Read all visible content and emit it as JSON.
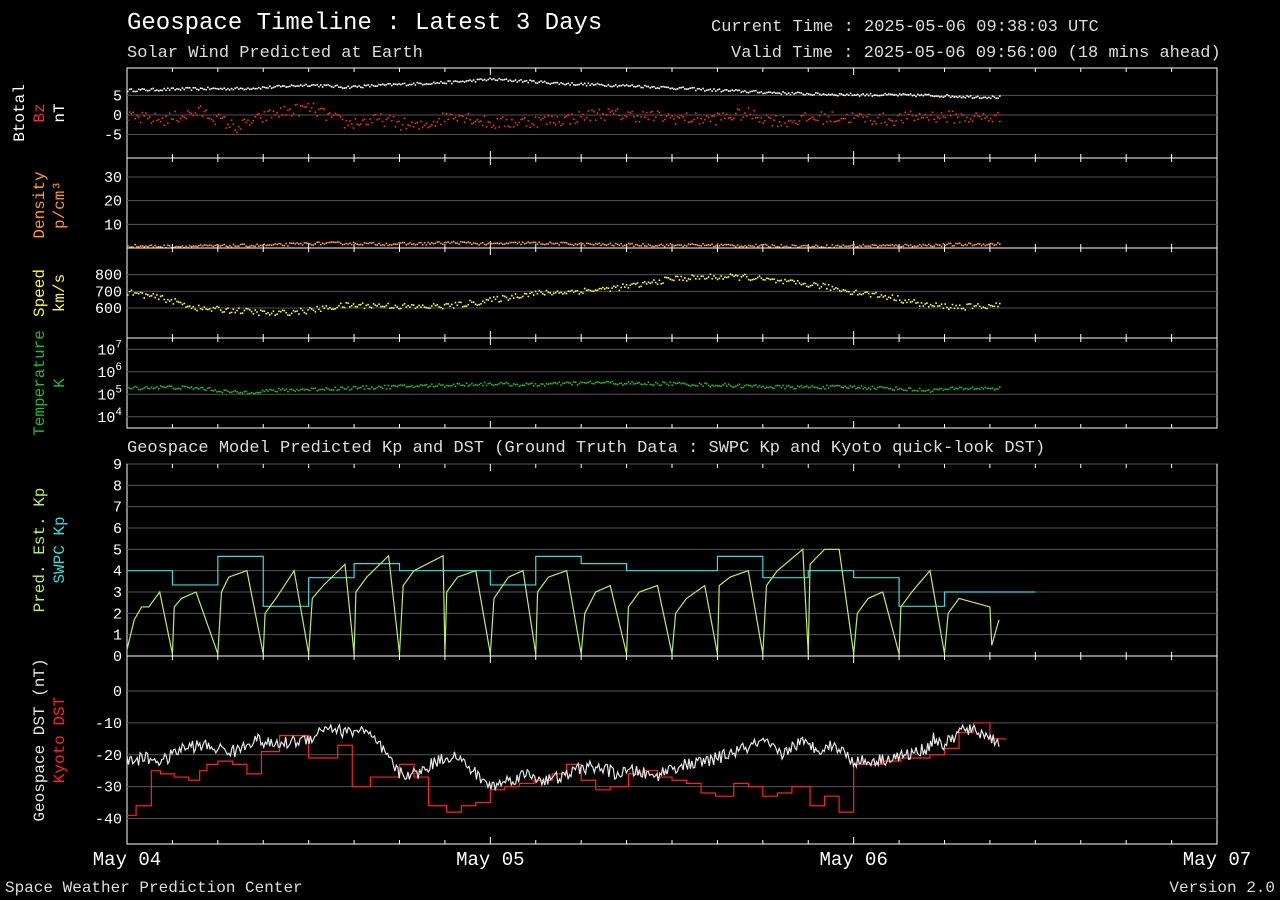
{
  "header": {
    "title": "Geospace Timeline : Latest 3 Days",
    "subtitle": "Solar Wind Predicted at Earth",
    "current_time": "Current Time : 2025-05-06 09:38:03 UTC",
    "valid_time": "Valid Time : 2025-05-06 09:56:00 (18 mins ahead)",
    "section_title": "Geospace Model Predicted Kp and DST (Ground Truth Data : SWPC Kp and Kyoto quick-look DST)"
  },
  "footer": {
    "left": "Space Weather Prediction Center",
    "right": "Version 2.0"
  },
  "colors": {
    "background": "#000000",
    "frame": "#ffffff",
    "grid": "#555555",
    "btotal": "#ffffff",
    "bz": "#ff2a2a",
    "density": "#ff9933",
    "speed": "#ffff33",
    "temperature": "#22bb22",
    "pred_kp": "#bbee66",
    "swpc_kp": "#33dddd",
    "geospace_dst": "#e8e8e8",
    "kyoto_dst": "#ff2222"
  },
  "chart_data": [
    {
      "type": "scatter",
      "panel": "magnetic_field",
      "ylabel_lines": [
        {
          "text": "Btotal",
          "color": "#ffffff"
        },
        {
          "text": "Bz",
          "color": "#ff2a2a"
        },
        {
          "text": "nT",
          "color": "#ffffff"
        }
      ],
      "ylim": [
        -11,
        12
      ],
      "yticks": [
        5,
        0,
        -5
      ],
      "ytick_labels": [
        "5",
        "0",
        "-5"
      ],
      "grid": true,
      "series": [
        {
          "name": "Btotal",
          "x": [
            0,
            0.1,
            0.2,
            0.3,
            0.4,
            0.5,
            0.6,
            0.7,
            0.8,
            0.9,
            1.0,
            1.1,
            1.2,
            1.3,
            1.4,
            1.5,
            1.6,
            1.7,
            1.8,
            1.9,
            2.0,
            2.1,
            2.2,
            2.3,
            2.4
          ],
          "values": [
            6.5,
            6.7,
            6.9,
            6.9,
            7.3,
            7.9,
            7.3,
            7.8,
            8.2,
            8.6,
            9.3,
            8.8,
            8.2,
            7.9,
            7.6,
            7.1,
            6.6,
            6.2,
            5.8,
            5.5,
            5.4,
            5.3,
            5.2,
            4.9,
            4.7
          ]
        },
        {
          "name": "Bz",
          "x": [
            0,
            0.1,
            0.2,
            0.3,
            0.4,
            0.5,
            0.6,
            0.7,
            0.8,
            0.9,
            1.0,
            1.1,
            1.2,
            1.3,
            1.4,
            1.5,
            1.6,
            1.7,
            1.8,
            1.9,
            2.0,
            2.1,
            2.2,
            2.3,
            2.4
          ],
          "values": [
            -0.5,
            -1,
            1,
            -3,
            0.5,
            2,
            -2,
            -1,
            -3,
            0.5,
            -2,
            -1.5,
            -1,
            0.5,
            0,
            -0.5,
            -1,
            0.5,
            -1.5,
            -0.5,
            -0.5,
            -1,
            0,
            -0.5,
            -0.5
          ]
        }
      ]
    },
    {
      "type": "scatter",
      "panel": "density",
      "ylabel_lines": [
        {
          "text": "Density",
          "color": "#ff9933"
        },
        {
          "text": "p/cm³",
          "color": "#ff9933"
        }
      ],
      "ylim": [
        0,
        38
      ],
      "yticks": [
        30,
        20,
        10
      ],
      "ytick_labels": [
        "30",
        "20",
        "10"
      ],
      "grid": true,
      "series": [
        {
          "name": "Density",
          "x": [
            0,
            0.1,
            0.2,
            0.3,
            0.4,
            0.5,
            0.6,
            0.7,
            0.8,
            0.9,
            1.0,
            1.1,
            1.2,
            1.3,
            1.4,
            1.5,
            1.6,
            1.7,
            1.8,
            1.9,
            2.0,
            2.1,
            2.2,
            2.3,
            2.4
          ],
          "values": [
            1.2,
            1.0,
            1.1,
            1.3,
            1.5,
            2.2,
            2.3,
            2.0,
            2.1,
            2.6,
            2.0,
            2.4,
            2.1,
            1.8,
            1.6,
            1.5,
            1.6,
            1.3,
            1.2,
            1.0,
            1.3,
            1.3,
            1.5,
            1.8,
            2.0
          ]
        }
      ]
    },
    {
      "type": "scatter",
      "panel": "speed",
      "ylabel_lines": [
        {
          "text": "Speed",
          "color": "#ffff33"
        },
        {
          "text": "km/s",
          "color": "#ffff33"
        }
      ],
      "ylim": [
        420,
        960
      ],
      "yticks": [
        800,
        700,
        600
      ],
      "ytick_labels": [
        "800",
        "700",
        "600"
      ],
      "grid": true,
      "series": [
        {
          "name": "Speed",
          "x": [
            0,
            0.1,
            0.2,
            0.3,
            0.4,
            0.5,
            0.6,
            0.7,
            0.8,
            0.9,
            1.0,
            1.1,
            1.2,
            1.3,
            1.4,
            1.5,
            1.6,
            1.7,
            1.8,
            1.9,
            2.0,
            2.1,
            2.2,
            2.3,
            2.4
          ],
          "values": [
            700,
            660,
            600,
            590,
            570,
            590,
            620,
            620,
            610,
            620,
            650,
            690,
            700,
            715,
            740,
            780,
            790,
            790,
            760,
            740,
            700,
            670,
            620,
            610,
            620
          ]
        }
      ]
    },
    {
      "type": "scatter",
      "panel": "temperature",
      "ylabel_lines": [
        {
          "text": "Temperature",
          "color": "#22bb22"
        },
        {
          "text": "K",
          "color": "#22bb22"
        }
      ],
      "log_scale": true,
      "ylim": [
        3.5,
        7.5
      ],
      "yticks": [
        7,
        6,
        5,
        4
      ],
      "ytick_labels": [
        "10^7",
        "10^6",
        "10^5",
        "10^4"
      ],
      "grid": true,
      "series": [
        {
          "name": "Temperature",
          "x": [
            0,
            0.1,
            0.2,
            0.3,
            0.4,
            0.5,
            0.6,
            0.7,
            0.8,
            0.9,
            1.0,
            1.1,
            1.2,
            1.3,
            1.4,
            1.5,
            1.6,
            1.7,
            1.8,
            1.9,
            2.0,
            2.1,
            2.2,
            2.3,
            2.4
          ],
          "values": [
            5.3,
            5.35,
            5.3,
            5.1,
            5.2,
            5.25,
            5.3,
            5.35,
            5.4,
            5.45,
            5.5,
            5.45,
            5.5,
            5.55,
            5.5,
            5.5,
            5.45,
            5.4,
            5.35,
            5.35,
            5.35,
            5.3,
            5.2,
            5.3,
            5.3
          ]
        }
      ]
    },
    {
      "type": "line",
      "panel": "kp",
      "ylabel_lines": [
        {
          "text": "Pred. Est. Kp",
          "color": "#bbee66"
        },
        {
          "text": "SWPC Kp",
          "color": "#33dddd"
        }
      ],
      "ylim": [
        0,
        9
      ],
      "yticks": [
        9,
        8,
        7,
        6,
        5,
        4,
        3,
        2,
        1,
        0
      ],
      "ytick_labels": [
        "9",
        "8",
        "7",
        "6",
        "5",
        "4",
        "3",
        "2",
        "1",
        "0"
      ],
      "grid": true,
      "series": [
        {
          "name": "SWPC Kp",
          "step": true,
          "x": [
            0,
            0.125,
            0.25,
            0.375,
            0.5,
            0.625,
            0.75,
            0.875,
            1.0,
            1.125,
            1.25,
            1.375,
            1.5,
            1.625,
            1.75,
            1.875,
            2.0,
            2.125,
            2.25,
            2.375
          ],
          "values": [
            4.0,
            3.33,
            4.67,
            2.33,
            3.67,
            4.33,
            4.0,
            4.0,
            3.33,
            4.67,
            4.33,
            4.0,
            4.0,
            4.67,
            3.67,
            4.0,
            3.67,
            2.33,
            3.0,
            3.0
          ]
        },
        {
          "name": "Pred. Est. Kp",
          "step": false,
          "x": [
            0,
            0.02,
            0.04,
            0.06,
            0.09,
            0.125,
            0.13,
            0.15,
            0.19,
            0.25,
            0.26,
            0.28,
            0.33,
            0.375,
            0.38,
            0.41,
            0.46,
            0.5,
            0.51,
            0.54,
            0.6,
            0.625,
            0.63,
            0.66,
            0.72,
            0.75,
            0.76,
            0.79,
            0.87,
            0.875,
            0.88,
            0.91,
            0.96,
            1.0,
            1.01,
            1.05,
            1.09,
            1.125,
            1.13,
            1.16,
            1.21,
            1.25,
            1.26,
            1.29,
            1.33,
            1.375,
            1.38,
            1.41,
            1.46,
            1.5,
            1.51,
            1.54,
            1.59,
            1.625,
            1.63,
            1.66,
            1.71,
            1.75,
            1.76,
            1.79,
            1.86,
            1.875,
            1.88,
            1.92,
            1.96,
            2.0,
            2.01,
            2.04,
            2.08,
            2.125,
            2.13,
            2.16,
            2.21,
            2.25,
            2.26,
            2.29,
            2.375,
            2.38,
            2.4
          ],
          "values": [
            0.3,
            1.7,
            2.3,
            2.3,
            3.0,
            0.1,
            2.3,
            2.7,
            3.0,
            0.1,
            3.0,
            3.7,
            4.0,
            0.1,
            2.0,
            2.7,
            4.0,
            0.1,
            2.7,
            3.3,
            4.3,
            0.1,
            3.0,
            3.7,
            4.7,
            0.1,
            3.3,
            4.0,
            4.7,
            0.1,
            3.0,
            3.7,
            4.0,
            0.1,
            2.7,
            3.7,
            4.0,
            0.1,
            3.0,
            3.7,
            4.0,
            0.1,
            2.0,
            3.0,
            3.3,
            0.1,
            2.3,
            3.0,
            3.3,
            0.1,
            2.0,
            2.7,
            3.3,
            0.1,
            3.3,
            3.7,
            4.0,
            0.1,
            3.3,
            4.0,
            5.0,
            0.1,
            4.3,
            5.0,
            5.0,
            0.1,
            2.0,
            2.7,
            3.0,
            0.1,
            2.3,
            3.0,
            4.0,
            0.1,
            2.0,
            2.7,
            2.3,
            0.5,
            1.7
          ]
        }
      ]
    },
    {
      "type": "line",
      "panel": "dst",
      "ylabel_lines": [
        {
          "text": "Geospace DST (nT)",
          "color": "#e8e8e8"
        },
        {
          "text": "Kyoto DST",
          "color": "#ff2222"
        }
      ],
      "ylim": [
        -48,
        11
      ],
      "yticks": [
        0,
        -10,
        -20,
        -30,
        -40
      ],
      "ytick_labels": [
        "0",
        "-10",
        "-20",
        "-30",
        "-40"
      ],
      "grid": true,
      "series": [
        {
          "name": "Kyoto DST",
          "step": true,
          "x": [
            0,
            0.025,
            0.067,
            0.092,
            0.13,
            0.17,
            0.2,
            0.22,
            0.25,
            0.29,
            0.33,
            0.37,
            0.42,
            0.5,
            0.54,
            0.58,
            0.62,
            0.67,
            0.71,
            0.75,
            0.79,
            0.83,
            0.88,
            0.92,
            0.96,
            1.0,
            1.04,
            1.08,
            1.12,
            1.17,
            1.21,
            1.25,
            1.29,
            1.33,
            1.38,
            1.42,
            1.46,
            1.5,
            1.54,
            1.58,
            1.62,
            1.67,
            1.71,
            1.75,
            1.79,
            1.83,
            1.88,
            1.92,
            1.96,
            2.0,
            2.04,
            2.08,
            2.13,
            2.17,
            2.21,
            2.25,
            2.29,
            2.33,
            2.375
          ],
          "values": [
            -39,
            -36,
            -25,
            -26,
            -27,
            -28,
            -25,
            -23,
            -22,
            -23,
            -26,
            -19,
            -14,
            -21,
            -21,
            -17,
            -30,
            -27,
            -27,
            -23,
            -27,
            -36,
            -38,
            -36,
            -35,
            -31,
            -30,
            -29,
            -28,
            -26,
            -23,
            -28,
            -31,
            -30,
            -26,
            -25,
            -27,
            -28,
            -29,
            -32,
            -33,
            -29,
            -30,
            -33,
            -32,
            -30,
            -36,
            -33,
            -38,
            -23,
            -23,
            -22,
            -21,
            -21,
            -20,
            -18,
            -13,
            -10,
            -15
          ]
        },
        {
          "name": "Geospace DST (nT)",
          "step": false,
          "x": [
            0,
            0.05,
            0.1,
            0.15,
            0.2,
            0.25,
            0.3,
            0.35,
            0.4,
            0.45,
            0.5,
            0.55,
            0.6,
            0.65,
            0.7,
            0.75,
            0.8,
            0.85,
            0.9,
            0.95,
            1.0,
            1.05,
            1.1,
            1.15,
            1.2,
            1.25,
            1.3,
            1.35,
            1.4,
            1.45,
            1.5,
            1.55,
            1.6,
            1.65,
            1.7,
            1.75,
            1.8,
            1.85,
            1.9,
            1.95,
            2.0,
            2.05,
            2.1,
            2.15,
            2.2,
            2.22,
            2.25,
            2.3,
            2.35,
            2.4
          ],
          "values": [
            -22,
            -21,
            -22,
            -18,
            -17,
            -18,
            -19,
            -15,
            -17,
            -16,
            -15,
            -11,
            -13,
            -12,
            -18,
            -26,
            -26,
            -22,
            -20,
            -25,
            -30,
            -28,
            -26,
            -28,
            -27,
            -24,
            -24,
            -26,
            -25,
            -27,
            -24,
            -23,
            -22,
            -20,
            -18,
            -16,
            -20,
            -16,
            -18,
            -17,
            -22,
            -22,
            -21,
            -20,
            -18,
            -15,
            -17,
            -12,
            -13,
            -16
          ]
        }
      ]
    }
  ],
  "xaxis": {
    "ticks": [
      {
        "value": 0,
        "label": "May 04"
      },
      {
        "value": 1,
        "label": "May 05"
      },
      {
        "value": 2,
        "label": "May 06"
      },
      {
        "value": 3,
        "label": "May 07"
      }
    ],
    "range": [
      0,
      3
    ],
    "unit": "days since May 04 00:00 UTC"
  }
}
